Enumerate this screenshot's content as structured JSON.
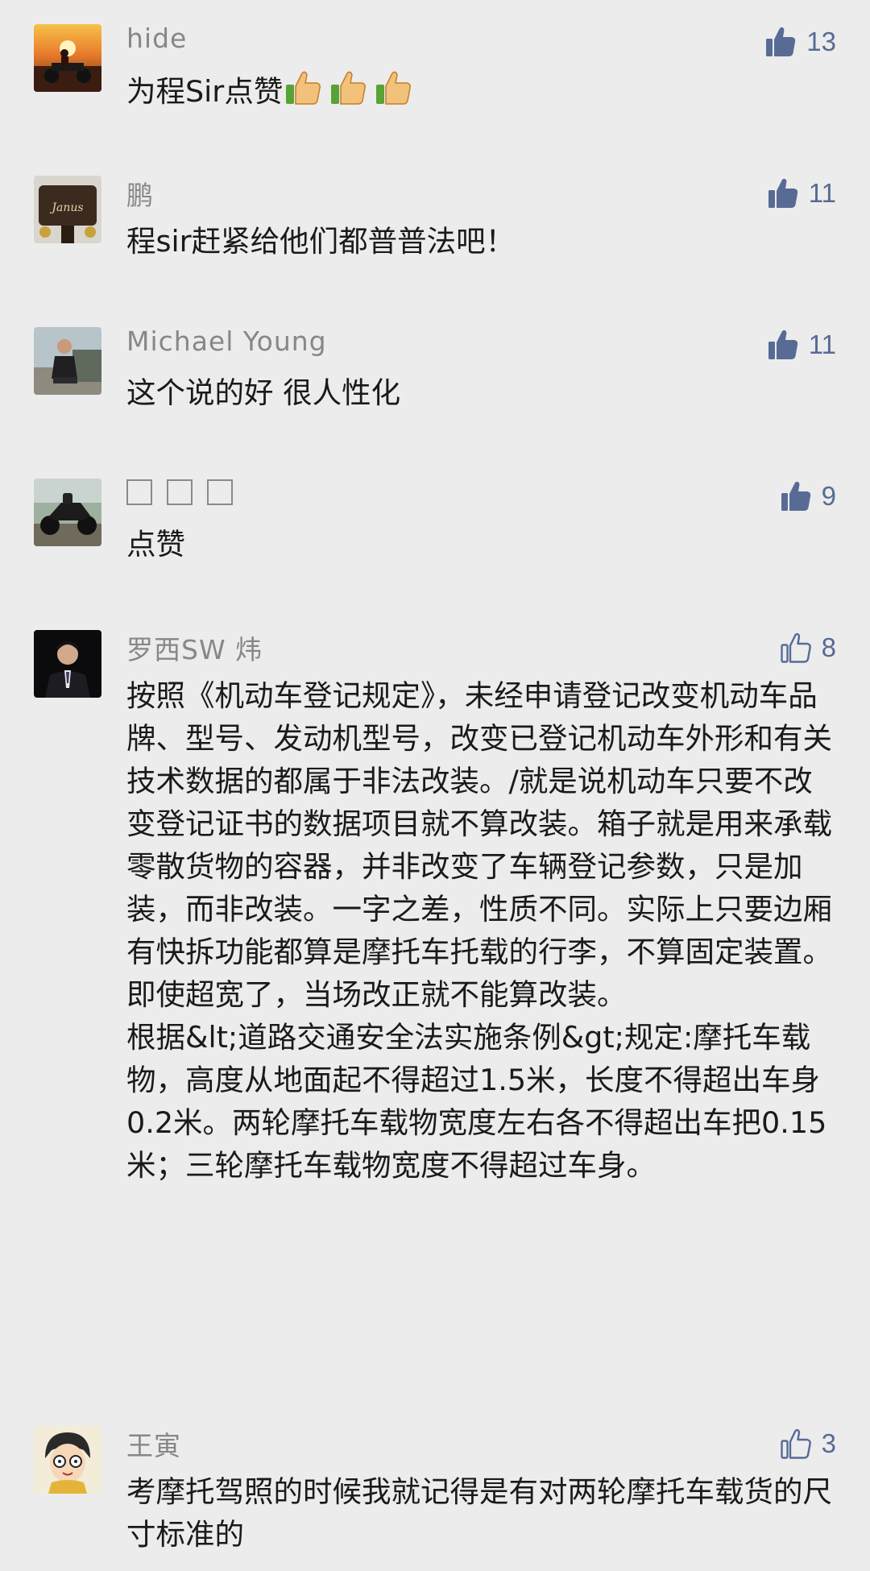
{
  "accent_color": "#576b95",
  "comments": [
    {
      "name": "hide",
      "text": "为程Sir点赞",
      "emoji": [
        "thumbs-up-emoji",
        "thumbs-up-emoji",
        "thumbs-up-emoji"
      ],
      "likes": "13",
      "liked": true
    },
    {
      "name": "鹏",
      "text": "程sir赶紧给他们都普普法吧！",
      "likes": "11",
      "liked": true
    },
    {
      "name": "Michael Young",
      "text": "这个说的好 很人性化",
      "likes": "11",
      "liked": true
    },
    {
      "name": "□ □ □",
      "text": "点赞",
      "likes": "9",
      "liked": true
    },
    {
      "name": "罗西SW 炜",
      "text": "按照《机动车登记规定》，未经申请登记改变机动车品牌、型号、发动机型号，改变已登记机动车外形和有关技术数据的都属于非法改装。/就是说机动车只要不改变登记证书的数据项目就不算改装。箱子就是用来承载零散货物的容器，并非改变了车辆登记参数，只是加装，而非改装。一字之差，性质不同。实际上只要边厢有快拆功能都算是摩托车托载的行李，不算固定装置。即使超宽了，当场改正就不能算改装。\n根据&lt;道路交通安全法实施条例&gt;规定:摩托车载物，高度从地面起不得超过1.5米，长度不得超出车身0.2米。两轮摩托车载物宽度左右各不得超出车把0.15米；三轮摩托车载物宽度不得超过车身。",
      "likes": "8",
      "liked": false
    },
    {
      "name": "王寅",
      "text": "考摩托驾照的时候我就记得是有对两轮摩托车载货的尺寸标准的",
      "likes": "3",
      "liked": false
    }
  ]
}
